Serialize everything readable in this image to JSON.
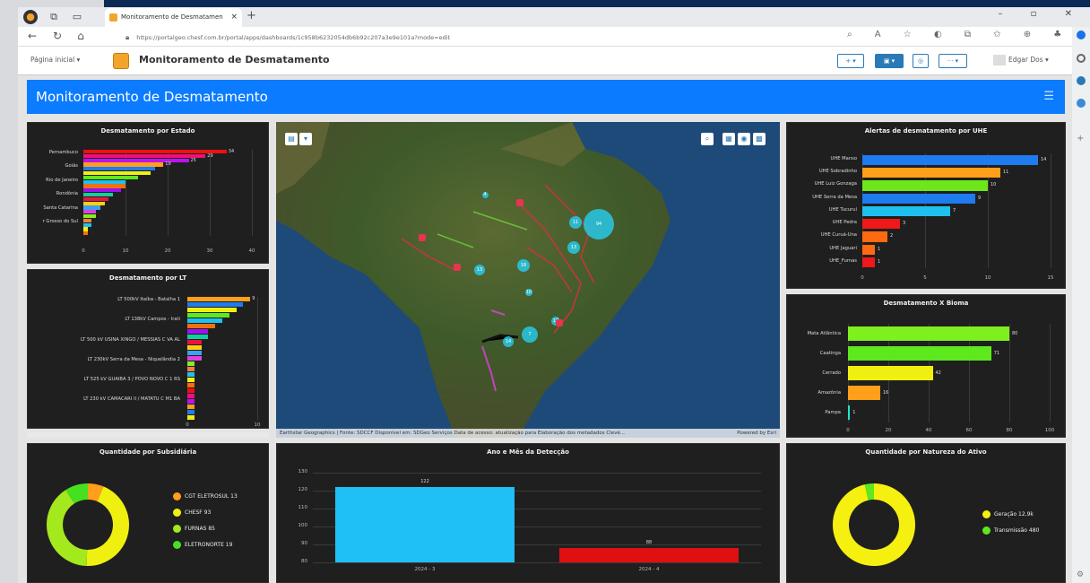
{
  "browser": {
    "tab_title": "Monitoramento de Desmatamen",
    "new_tab": "+",
    "url": "https://portalgeo.chesf.com.br/portal/apps/dashboards/1c958b6232054db6b92c207a3e9e101a?mode=edit",
    "window_controls": "– ▫ ✕"
  },
  "app": {
    "home_label": "Página inicial",
    "title": "Monitoramento de Desmatamento",
    "user": "Edgar Dos"
  },
  "dashboard": {
    "header": "Monitoramento de Desmatamento"
  },
  "panels": {
    "estado": {
      "title": "Desmatamento por Estado",
      "labels": [
        "Pernambuco",
        "Goiás",
        "Rio de Janeiro",
        "Rondônia",
        "Santa Catarina",
        "Mato Grosso do Sul"
      ],
      "shown_labels": [
        "Pernambuco",
        "Goiás",
        "Rio de Janeiro",
        "Rondônia",
        "Santa Catarina",
        "r Grosso do Sul"
      ],
      "values": [
        34,
        29,
        25,
        19,
        17,
        16,
        13,
        10,
        10,
        9,
        7,
        6,
        5,
        4,
        3,
        3,
        2,
        2,
        1,
        1
      ],
      "value_labels": [
        "34",
        "29",
        "25",
        "19"
      ],
      "ticks": [
        "0",
        "10",
        "20",
        "30",
        "40"
      ]
    },
    "lt": {
      "title": "Desmatamento por LT",
      "labels": [
        "LT 500kV Itaíba - Batalha 1",
        "LT 138kV Campos - Irati",
        "LT 500 kV USINA XINGO / MESSIAS C VA AL",
        "LT 230kV Serra da Mesa - Niquelândia 2",
        "LT 525 kV GUAIBA 3 / POVO NOVO C 1 RS",
        "LT 230 kV CAMACARI II / MATATU C M1 BA"
      ],
      "values": [
        9,
        8,
        7,
        6,
        5,
        4,
        3,
        3,
        2,
        2,
        2,
        2,
        1,
        1,
        1,
        1,
        1,
        1,
        1,
        1,
        1,
        1,
        1
      ],
      "top_value": "9",
      "ticks": [
        "0",
        "10"
      ]
    },
    "uhe": {
      "title": "Alertas de desmatamento por UHE",
      "labels": [
        "UHE Manso",
        "UHE Sobradinho",
        "UHE Luiz Gonzaga",
        "UHE Serra da Mesa",
        "UHE Tucuruí",
        "UHE Pedra",
        "UHE Curuá-Una",
        "UHE Jaguari",
        "UHE_Furnas"
      ],
      "values": [
        14,
        11,
        10,
        9,
        7,
        3,
        2,
        1,
        1
      ],
      "value_labels": [
        "14",
        "11",
        "10",
        "9",
        "7",
        "3",
        "2",
        "1",
        "1"
      ],
      "colors": [
        "#1e7bf0",
        "#ff9f1a",
        "#6ee71a",
        "#1e7bf0",
        "#1ec0ee",
        "#f01818",
        "#ff6a10",
        "#ff6a10",
        "#f01818"
      ],
      "ticks": [
        "0",
        "5",
        "10",
        "15"
      ]
    },
    "bioma": {
      "title": "Desmatamento X Bioma",
      "labels": [
        "Mata Atlântica",
        "Caatinga",
        "Cerrado",
        "Amazônia",
        "Pampa"
      ],
      "values": [
        80,
        71,
        42,
        16,
        1
      ],
      "value_labels": [
        "80",
        "71",
        "42",
        "16",
        "1"
      ],
      "colors": [
        "#7ef01e",
        "#5ee81e",
        "#f0f010",
        "#ff9f1a",
        "#1ee8c8"
      ],
      "ticks": [
        "0",
        "20",
        "40",
        "60",
        "80",
        "100"
      ]
    },
    "subsidiaria": {
      "title": "Quantidade por Subsidiária",
      "legend": [
        "CGT ELETROSUL  13",
        "CHESF  93",
        "FURNAS  85",
        "ELETRONORTE  19"
      ],
      "values": [
        13,
        93,
        85,
        19
      ],
      "colors": [
        "#ff9f1a",
        "#f0f010",
        "#a4e81e",
        "#46e020"
      ]
    },
    "ano_mes": {
      "title": "Ano e Mês da Detecção",
      "categories": [
        "2024 - 3",
        "2024 - 4"
      ],
      "values": [
        122,
        88
      ],
      "value_labels": [
        "122",
        "88"
      ],
      "colors": [
        "#1ec0f5",
        "#e01010"
      ],
      "yticks": [
        "130",
        "120",
        "110",
        "100",
        "90",
        "80"
      ],
      "ylim": [
        80,
        130
      ]
    },
    "natureza": {
      "title": "Quantidade por Natureza do Ativo",
      "legend": [
        "Geração  12,9k",
        "Transmissão  480"
      ],
      "values": [
        12900,
        480
      ],
      "colors": [
        "#f5f010",
        "#5ee81e"
      ]
    }
  },
  "map": {
    "attribution": "Earthstar Geographics | Fonte: SDCCF Disponível em: SDGeo Serviços Data de acesso: atualização para Elaboração dos metadados Clevé...",
    "powered": "Powered by Esri",
    "clusters": [
      "94",
      "11",
      "13",
      "18",
      "13",
      "7",
      "14",
      "4",
      "10",
      "16"
    ]
  }
}
